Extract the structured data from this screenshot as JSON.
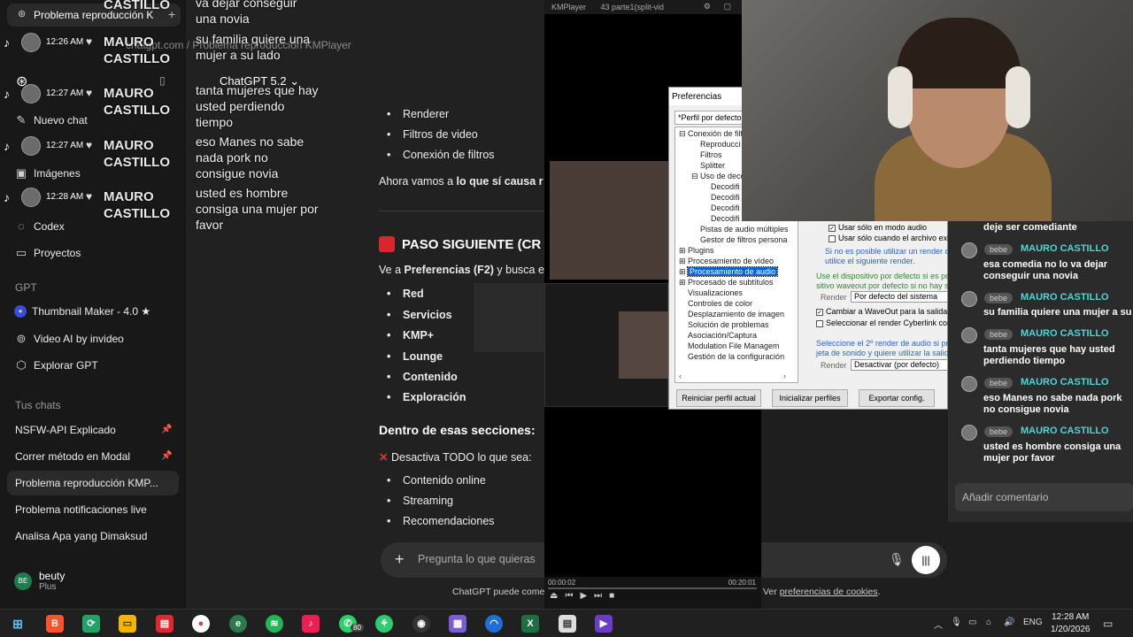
{
  "browser_tab": {
    "title": "Problema reproducción K",
    "plus": "+"
  },
  "sidebar": {
    "nav": [
      {
        "label": "Nuevo chat",
        "icon": "edit-icon"
      },
      {
        "label": "Imágenes",
        "icon": "image-icon"
      },
      {
        "label": "Codex",
        "icon": "codex-icon"
      },
      {
        "label": "Proyectos",
        "icon": "folder-icon"
      }
    ],
    "gpt_section": "GPT",
    "gpts": [
      {
        "label": "Thumbnail Maker - 4.0 ★",
        "icon": "thumbnail-icon"
      },
      {
        "label": "Video AI by invideo",
        "icon": "video-icon"
      },
      {
        "label": "Explorar GPT",
        "icon": "cube-icon"
      }
    ],
    "chats_section": "Tus chats",
    "chats": [
      {
        "label": "NSFW-API Explicado",
        "pinned": true
      },
      {
        "label": "Correr método en Modal",
        "pinned": true
      },
      {
        "label": "Problema reproducción KMP...",
        "active": true
      },
      {
        "label": "Problema notificaciones live"
      },
      {
        "label": "Analisa Apa yang Dimaksud"
      }
    ],
    "user": {
      "initials": "BE",
      "name": "beuty",
      "plan": "Plus"
    }
  },
  "main": {
    "breadcrumb": "chatgpt.com / Problema reproducción KMPlayer",
    "model": "ChatGPT 5.2 ⌄",
    "list1": [
      "Renderer",
      "Filtros de video",
      "Conexión de filtros"
    ],
    "para1_a": "Ahora vamos a ",
    "para1_b": "lo que sí causa r",
    "heading": "PASO SIGUIENTE (CR",
    "para2_a": "Ve a ",
    "para2_b": "Preferencias (F2)",
    "para2_c": " y busca e",
    "list2": [
      "Red",
      "Servicios",
      "KMP+",
      "Lounge",
      "Contenido",
      "Exploración"
    ],
    "section_title": "Dentro de esas secciones:",
    "deactivate": "Desactiva TODO lo que sea:",
    "list3": [
      "Contenido online",
      "Streaming",
      "Recomendaciones"
    ],
    "composer_placeholder": "Pregunta lo que quieras",
    "footer_a": "ChatGPT puede comete",
    "footer_b": "Ver ",
    "footer_link": "preferencias de cookies",
    "footer_c": "."
  },
  "tiktok_comments": [
    {
      "time": "12:26 AM",
      "name": "MAURO\nCASTILLO",
      "msg": "su familia quiere una mujer a su lado"
    },
    {
      "time": "12:27 AM",
      "name": "MAURO\nCASTILLO",
      "msg": "tanta mujeres que hay usted perdiendo tiempo"
    },
    {
      "time": "12:27 AM",
      "name": "MAURO\nCASTILLO",
      "msg": "eso Manes no sabe nada pork no consigue novia"
    },
    {
      "time": "12:28 AM",
      "name": "MAURO\nCASTILLO",
      "msg": "usted es hombre consiga una mujer por favor"
    }
  ],
  "tiktok_top": {
    "name": "CASTILLO",
    "msg": "va dejar conseguir una novia"
  },
  "kmplayer": {
    "title": "KMPlayer",
    "file": "43 parte1(split-vid",
    "time_now": "00:00:02",
    "time_total": "00:20:01"
  },
  "preferences": {
    "title": "Preferencias",
    "profile": "*Perfil por defecto",
    "tree": [
      "Conexión de filtr",
      "Reproducci",
      "Filtros",
      "Splitter",
      "Uso de deco",
      "Decodifi",
      "Decodifi",
      "Decodifi",
      "Decodifi",
      "Pistas de audio múltiples",
      "Gestor de filtros persona",
      "Plugins",
      "Procesamiento de vídeo",
      "Procesamiento de audio",
      "Procesado de subtítulos",
      "Visualizaciones",
      "Controles de color",
      "Desplazamiento de imagen",
      "Solución de problemas",
      "Asociación/Captura",
      "Modulation File Managem",
      "Gestión de la configuración"
    ],
    "right": {
      "opt1": "Usar sólo en modo audio",
      "opt2": "Usar sólo cuando el archivo existe físicamente en el disco",
      "note1": "Si no es posible utilizar un render de a",
      "note1b": "utilice el siguiente render.",
      "note2": "Use el dispositivo por defecto si es posible. Se",
      "note2b": "sitivo waveout por defecto si no hay soporte",
      "render_label": "Render",
      "render_value": "Por defecto del sistema",
      "opt3": "Cambiar a WaveOut para la salida SPDIF",
      "opt4": "Seleccionar el render Cyberlink con su propio decodificador",
      "note3": "Seleccione el 2º render de audio si pr",
      "note3b": "jeta de sonido y quiere utilizar la salida",
      "render2_value": "Desactivar (por defecto)"
    },
    "buttons": [
      "Reiniciar perfil actual",
      "Inicializar perfiles",
      "Exportar config."
    ]
  },
  "live_comments": [
    {
      "badge": "",
      "name": "",
      "msg": "deje ser comediante"
    },
    {
      "badge": "bebe",
      "name": "MAURO CASTILLO",
      "msg": "esa comedia no lo va dejar conseguir una novia"
    },
    {
      "badge": "bebe",
      "name": "MAURO CASTILLO",
      "msg": "su familia quiere una mujer a su lado"
    },
    {
      "badge": "bebe",
      "name": "MAURO CASTILLO",
      "msg": "tanta mujeres que hay usted perdiendo tiempo"
    },
    {
      "badge": "bebe",
      "name": "MAURO CASTILLO",
      "msg": "eso Manes no sabe nada pork no consigue novia"
    },
    {
      "badge": "bebe",
      "name": "MAURO CASTILLO",
      "msg": "usted es hombre consiga una mujer por favor"
    }
  ],
  "live_input_placeholder": "Añadir comentario",
  "taskbar": {
    "lang": "ENG",
    "time": "12:28 AM",
    "date": "1/20/2026",
    "whatsapp_badge": "80"
  }
}
